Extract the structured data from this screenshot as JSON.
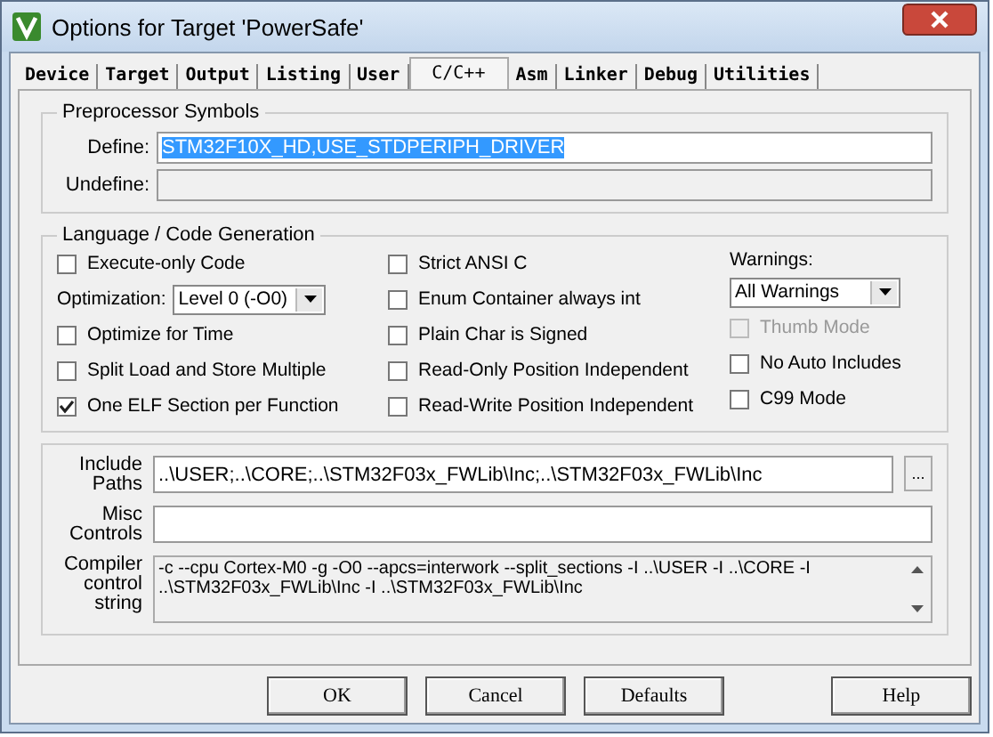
{
  "window": {
    "title": "Options for Target 'PowerSafe'"
  },
  "tabs": [
    {
      "label": "Device",
      "selected": false
    },
    {
      "label": "Target",
      "selected": false
    },
    {
      "label": "Output",
      "selected": false
    },
    {
      "label": "Listing",
      "selected": false
    },
    {
      "label": "User",
      "selected": false
    },
    {
      "label": "C/C++",
      "selected": true
    },
    {
      "label": "Asm",
      "selected": false
    },
    {
      "label": "Linker",
      "selected": false
    },
    {
      "label": "Debug",
      "selected": false
    },
    {
      "label": "Utilities",
      "selected": false
    }
  ],
  "preprocessor": {
    "title": "Preprocessor Symbols",
    "define": {
      "label": "Define:",
      "value": "STM32F10X_HD,USE_STDPERIPH_DRIVER",
      "highlighted": true
    },
    "undefine": {
      "label": "Undefine:",
      "disabled": true
    }
  },
  "codegen": {
    "title": "Language / Code Generation",
    "left": [
      {
        "kind": "checkbox",
        "label": "Execute-only Code",
        "checked": false
      },
      {
        "kind": "select",
        "label": "Optimization:",
        "value": "Level 0 (-O0)"
      },
      {
        "kind": "checkbox",
        "label": "Optimize for Time",
        "checked": false
      },
      {
        "kind": "checkbox",
        "label": "Split Load and Store Multiple",
        "checked": false
      },
      {
        "kind": "checkbox",
        "label": "One ELF Section per Function",
        "checked": true
      }
    ],
    "middle": [
      {
        "kind": "checkbox",
        "label": "Strict ANSI C",
        "checked": false
      },
      {
        "kind": "checkbox",
        "label": "Enum Container always int",
        "checked": false
      },
      {
        "kind": "checkbox",
        "label": "Plain Char is Signed",
        "checked": false
      },
      {
        "kind": "checkbox",
        "label": "Read-Only Position Independent",
        "checked": false
      },
      {
        "kind": "checkbox",
        "label": "Read-Write Position Independent",
        "checked": false
      }
    ],
    "right": [
      {
        "kind": "heading",
        "label": "Warnings:"
      },
      {
        "kind": "select",
        "value": "All Warnings"
      },
      {
        "kind": "checkbox",
        "label": "Thumb Mode",
        "checked": false,
        "disabled": true
      },
      {
        "kind": "checkbox",
        "label": "No Auto Includes",
        "checked": false,
        "disabled": false
      },
      {
        "kind": "checkbox",
        "label": "C99 Mode",
        "checked": false,
        "disabled": false
      }
    ]
  },
  "paths": [
    {
      "kind": "field",
      "label": "Include Paths",
      "value": "..\\USER;..\\CORE;..\\STM32F03x_FWLib\\Inc;..\\STM32F03x_FWLib\\Inc",
      "browse": "..."
    },
    {
      "kind": "field",
      "label": "Misc Controls"
    },
    {
      "kind": "text-area",
      "label": "Compiler control string",
      "value": "-c --cpu Cortex-M0 -g -O0 --apcs=interwork --split_sections -I ..\\USER -I ..\\CORE -I ..\\STM32F03x_FWLib\\Inc -I ..\\STM32F03x_FWLib\\Inc"
    }
  ],
  "buttons": [
    {
      "label": "OK"
    },
    {
      "label": "Cancel"
    },
    {
      "label": "Defaults"
    },
    {
      "label": "Help"
    }
  ]
}
